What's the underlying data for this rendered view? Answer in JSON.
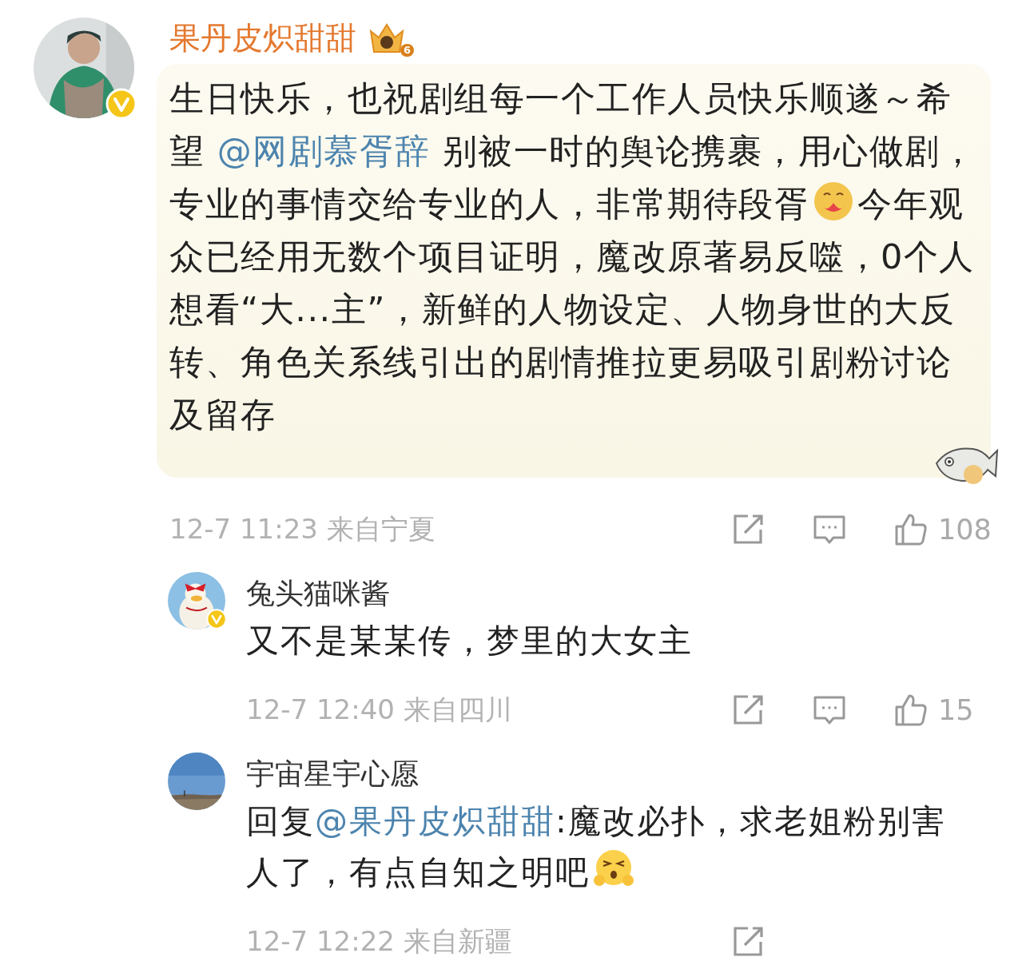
{
  "comment": {
    "author": "果丹皮炽甜甜",
    "verified": true,
    "avatar": {
      "kind": "picture"
    },
    "badge_level": "6",
    "content": [
      {
        "kind": "text",
        "text": "生日快乐，也祝剧组每一个工作人员快乐顺遂～希望 "
      },
      {
        "kind": "mention",
        "text": "@网剧慕胥辞"
      },
      {
        "kind": "text",
        "text": " 别被一时的舆论携裹，用心做剧，专业的事情交给专业的人，非常期待段胥"
      },
      {
        "kind": "hug"
      },
      {
        "kind": "text",
        "text": "今年观众已经用无数个项目证明，魔改原著易反噬，0个人想看“大...主”，新鲜的人物设定、人物身世的大反转、角色关系线引出的剧情推拉更易吸引剧粉讨论及留存"
      }
    ],
    "time": "12-7 11:23",
    "location": "来自宁夏",
    "actions": [
      {
        "kind": "share"
      },
      {
        "kind": "comment"
      },
      {
        "kind": "like",
        "count": "108"
      }
    ]
  },
  "replies": [
    {
      "author": "兔头猫咪酱",
      "verified": true,
      "avatar": {
        "kind": "picture"
      },
      "content": [
        {
          "kind": "text",
          "text": "又不是某某传，梦里的大女主"
        }
      ],
      "time": "12-7 12:40",
      "location": "来自四川",
      "actions": [
        {
          "kind": "share"
        },
        {
          "kind": "comment"
        },
        {
          "kind": "like",
          "count": "15"
        }
      ]
    },
    {
      "author": "宇宙星宇心愿",
      "verified": false,
      "avatar": {
        "kind": "picture"
      },
      "content": [
        {
          "kind": "text",
          "text": "回复"
        },
        {
          "kind": "mention",
          "text": "@果丹皮炽甜甜"
        },
        {
          "kind": "text",
          "text": ":魔改必扑，求老姐粉别害人了，有点自知之明吧"
        },
        {
          "kind": "huff"
        }
      ],
      "time": "12-7 12:22",
      "location": "来自新疆",
      "actions": [
        {
          "kind": "share"
        }
      ]
    }
  ]
}
